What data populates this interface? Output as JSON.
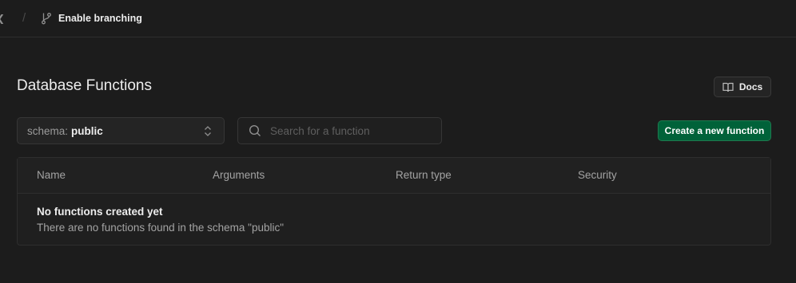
{
  "breadcrumb": {
    "separator": "/",
    "branch_label": "Enable branching"
  },
  "page": {
    "title": "Database Functions",
    "docs_label": "Docs"
  },
  "toolbar": {
    "schema_prefix": "schema:",
    "schema_value": "public",
    "search_placeholder": "Search for a function",
    "search_value": "",
    "create_label": "Create a new function"
  },
  "table": {
    "columns": [
      "Name",
      "Arguments",
      "Return type",
      "Security"
    ],
    "empty_title": "No functions created yet",
    "empty_description": "There are no functions found in the schema \"public\""
  },
  "colors": {
    "background": "#1c1c1c",
    "accent_green": "#006239"
  },
  "icons": {
    "branch": "git-branch-icon",
    "docs": "book-open-icon",
    "select": "chevron-up-down-icon",
    "search": "search-icon"
  }
}
